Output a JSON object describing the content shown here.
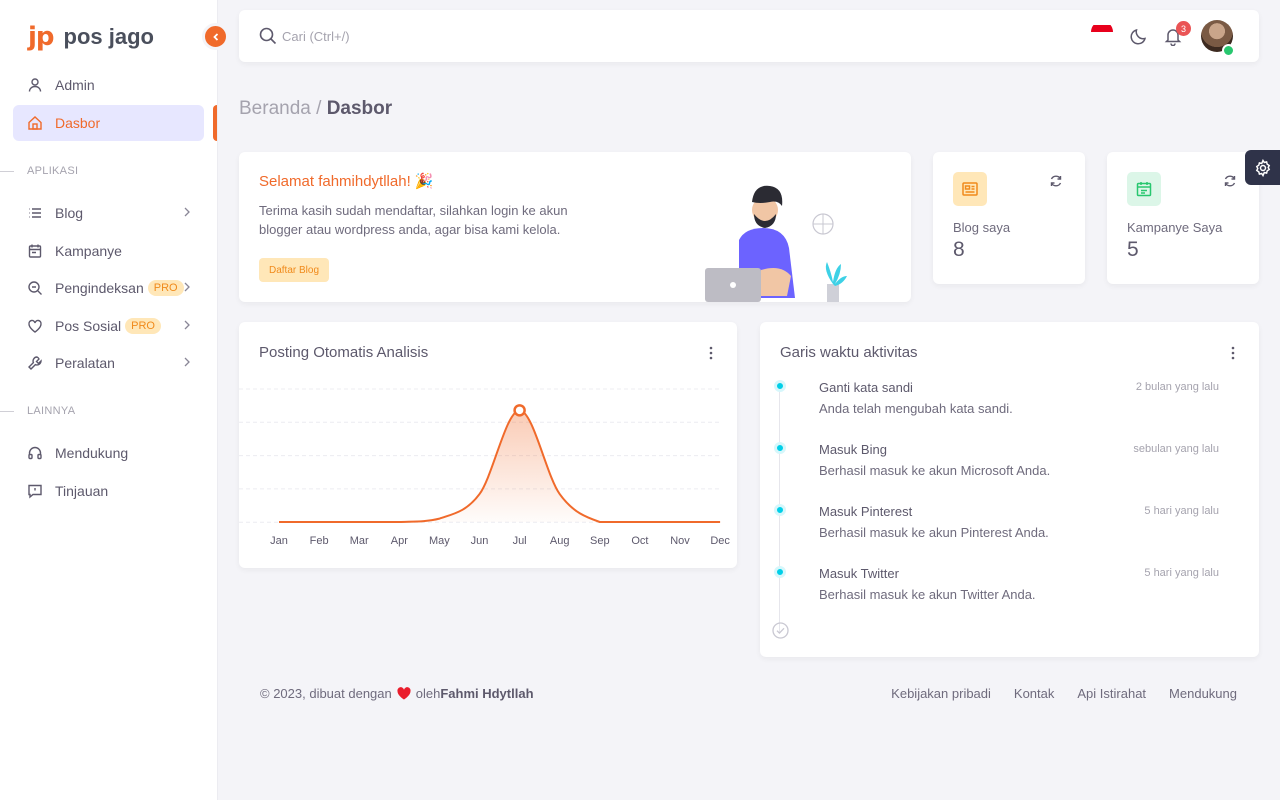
{
  "brand": {
    "logo": "jp",
    "name": "pos jago"
  },
  "sidebar": {
    "top_items": [
      {
        "label": "Admin"
      },
      {
        "label": "Dasbor"
      }
    ],
    "section_apps": "APLIKASI",
    "app_items": [
      {
        "label": "Blog"
      },
      {
        "label": "Kampanye"
      },
      {
        "label": "Pengindeksan",
        "badge": "PRO"
      },
      {
        "label": "Pos Sosial",
        "badge": "PRO"
      },
      {
        "label": "Peralatan"
      }
    ],
    "section_other": "LAINNYA",
    "other_items": [
      {
        "label": "Mendukung"
      },
      {
        "label": "Tinjauan"
      }
    ]
  },
  "navbar": {
    "search_placeholder": "Cari (Ctrl+/)",
    "notification_count": "3"
  },
  "breadcrumb": {
    "parent": "Beranda /",
    "current": "Dasbor"
  },
  "welcome": {
    "title": "Selamat fahmihdytllah! 🎉",
    "text": "Terima kasih sudah mendaftar, silahkan login ke akun blogger atau wordpress anda, agar bisa kami kelola.",
    "button": "Daftar Blog"
  },
  "stats": [
    {
      "label": "Blog saya",
      "value": "8",
      "color": "#f08a1b",
      "bg": "#ffe7b8"
    },
    {
      "label": "Kampanye Saya",
      "value": "5",
      "color": "#28c76f",
      "bg": "#dcf6e8"
    }
  ],
  "chart": {
    "title": "Posting Otomatis Analisis"
  },
  "chart_data": {
    "type": "area",
    "categories": [
      "Jan",
      "Feb",
      "Mar",
      "Apr",
      "May",
      "Jun",
      "Jul",
      "Aug",
      "Sep",
      "Oct",
      "Nov",
      "Dec"
    ],
    "values": [
      0,
      0,
      0,
      0,
      0.3,
      2.5,
      10,
      2.5,
      0,
      0,
      0,
      0
    ],
    "ylim": [
      0,
      12
    ],
    "grid": true,
    "color": "#f06a2b"
  },
  "timeline": {
    "title": "Garis waktu aktivitas",
    "items": [
      {
        "title": "Ganti kata sandi",
        "time": "2 bulan yang lalu",
        "desc": "Anda telah mengubah kata sandi."
      },
      {
        "title": "Masuk Bing",
        "time": "sebulan yang lalu",
        "desc": "Berhasil masuk ke akun Microsoft Anda."
      },
      {
        "title": "Masuk Pinterest",
        "time": "5 hari yang lalu",
        "desc": "Berhasil masuk ke akun Pinterest Anda."
      },
      {
        "title": "Masuk Twitter",
        "time": "5 hari yang lalu",
        "desc": "Berhasil masuk ke akun Twitter Anda."
      }
    ]
  },
  "footer": {
    "copyright": "© 2023, dibuat dengan",
    "by": "oleh",
    "author": "Fahmi Hdytllah",
    "links": [
      "Kebijakan pribadi",
      "Kontak",
      "Api Istirahat",
      "Mendukung"
    ]
  }
}
